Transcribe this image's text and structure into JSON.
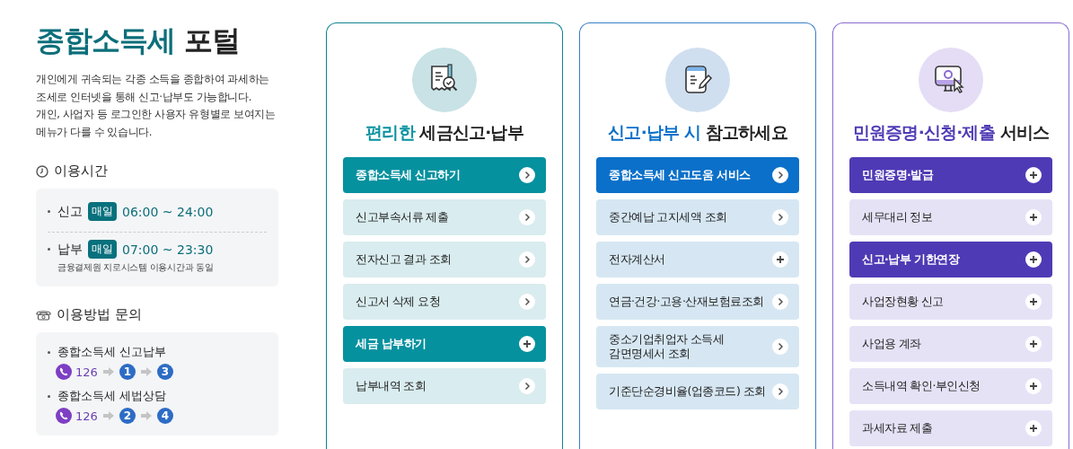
{
  "intro": {
    "title_highlight": "종합소득세",
    "title_rest": "포털",
    "description": "개인에게 귀속되는 각종 소득을 종합하여 과세하는 조세로 인터넷을 통해 신고·납부도 가능합니다.\n개인, 사업자 등 로그인한 사용자 유형별로 보여지는 메뉴가 다를 수 있습니다."
  },
  "hours": {
    "heading": "이용시간",
    "rows": [
      {
        "label": "신고",
        "badge": "매일",
        "time": "06:00 ~ 24:00"
      },
      {
        "label": "납부",
        "badge": "매일",
        "time": "07:00 ~ 23:30",
        "note": "금융결제원 지로시스템 이용시간과 동일"
      }
    ]
  },
  "contact": {
    "heading": "이용방법 문의",
    "rows": [
      {
        "label": "종합소득세 신고납부",
        "number": "126",
        "steps": [
          "1",
          "3"
        ]
      },
      {
        "label": "종합소득세 세법상담",
        "number": "126",
        "steps": [
          "2",
          "4"
        ]
      }
    ]
  },
  "cards": [
    {
      "kind": "teal",
      "title_highlight": "편리한",
      "title_rest": "세금신고·납부",
      "items": [
        {
          "label": "종합소득세 신고하기",
          "highlighted": true,
          "kind": "link"
        },
        {
          "label": "신고부속서류 제출",
          "highlighted": false,
          "kind": "link"
        },
        {
          "label": "전자신고 결과 조회",
          "highlighted": false,
          "kind": "link"
        },
        {
          "label": "신고서 삭제 요청",
          "highlighted": false,
          "kind": "link"
        },
        {
          "label": "세금 납부하기",
          "highlighted": true,
          "kind": "expand"
        },
        {
          "label": "납부내역 조회",
          "highlighted": false,
          "kind": "link"
        }
      ]
    },
    {
      "kind": "blue",
      "title_highlight": "신고·납부 시",
      "title_rest": "참고하세요",
      "items": [
        {
          "label": "종합소득세 신고도움 서비스",
          "highlighted": true,
          "kind": "link"
        },
        {
          "label": "중간예납 고지세액 조회",
          "highlighted": false,
          "kind": "link"
        },
        {
          "label": "전자계산서",
          "highlighted": false,
          "kind": "expand"
        },
        {
          "label": "연금·건강·고용·산재보험료조회",
          "highlighted": false,
          "kind": "link"
        },
        {
          "label": "중소기업취업자 소득세\n감면명세서 조회",
          "highlighted": false,
          "kind": "link"
        },
        {
          "label": "기준단순경비율(업종코드) 조회",
          "highlighted": false,
          "kind": "link"
        }
      ]
    },
    {
      "kind": "purple",
      "title_highlight": "민원증명·신청·제출",
      "title_rest": "서비스",
      "items": [
        {
          "label": "민원증명·발급",
          "highlighted": true,
          "kind": "expand"
        },
        {
          "label": "세무대리 정보",
          "highlighted": false,
          "kind": "expand"
        },
        {
          "label": "신고·납부 기한연장",
          "highlighted": true,
          "kind": "expand"
        },
        {
          "label": "사업장현황 신고",
          "highlighted": false,
          "kind": "expand"
        },
        {
          "label": "사업용 계좌",
          "highlighted": false,
          "kind": "expand"
        },
        {
          "label": "소득내역 확인·부인신청",
          "highlighted": false,
          "kind": "expand"
        },
        {
          "label": "과세자료 제출",
          "highlighted": false,
          "kind": "expand"
        }
      ]
    }
  ]
}
